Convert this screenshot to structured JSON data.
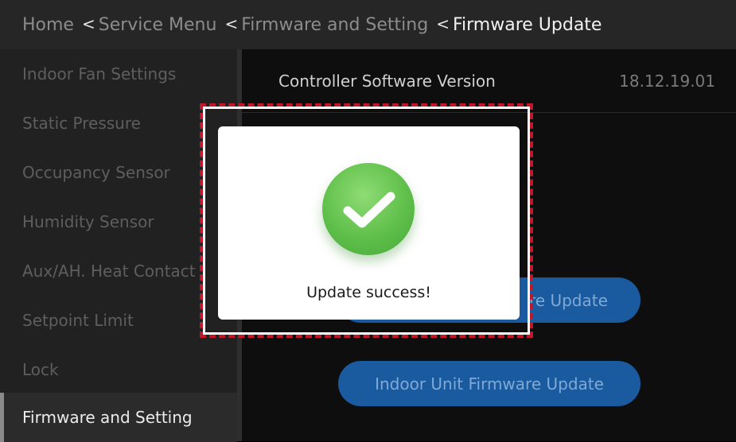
{
  "breadcrumb": {
    "items": [
      "Home",
      "Service Menu",
      "Firmware and Setting",
      "Firmware Update"
    ],
    "separator": "<"
  },
  "sidebar": {
    "items": [
      {
        "label": "Indoor Fan Settings"
      },
      {
        "label": "Static Pressure"
      },
      {
        "label": "Occupancy Sensor"
      },
      {
        "label": "Humidity Sensor"
      },
      {
        "label": "Aux/AH. Heat Contact"
      },
      {
        "label": "Setpoint Limit"
      },
      {
        "label": "Lock"
      },
      {
        "label": "Firmware and Setting"
      }
    ],
    "active_index": 7
  },
  "main": {
    "version_label": "Controller Software Version",
    "version_value": "18.12.19.01",
    "buttons": [
      "re Update",
      "Indoor Unit Firmware Update"
    ]
  },
  "dialog": {
    "icon": "check-circle-icon",
    "message": "Update success!"
  },
  "colors": {
    "success_green": "#5fbf4a",
    "button_blue": "#1a5a9e",
    "highlight_red": "#c0172a"
  }
}
